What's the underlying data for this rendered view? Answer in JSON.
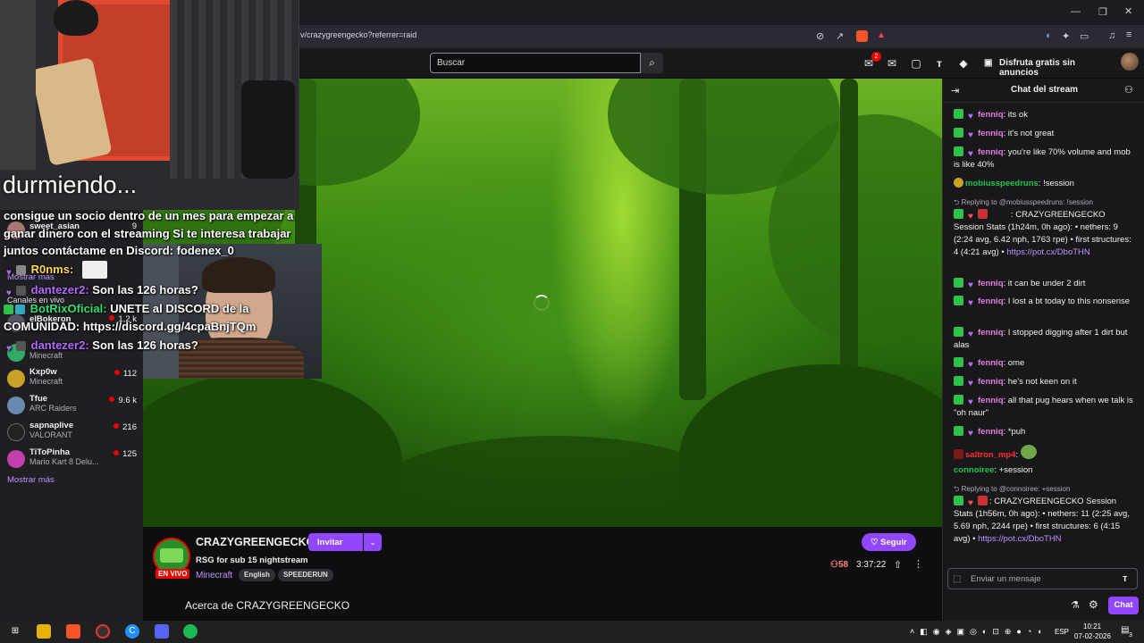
{
  "browser": {
    "url": "v/crazygreengecko?referrer=raid",
    "window_controls": [
      "minimize",
      "maximize",
      "close"
    ]
  },
  "topnav": {
    "search_placeholder": "Buscar",
    "notification_count": "2",
    "promo_label": "Disfruta gratis sin anuncios"
  },
  "overlay": {
    "title": "durmiendo...",
    "lines": [
      "consigue un socio dentro de un mes para empezar a",
      "ganar dinero con el streaming Si te interesa trabajar",
      "juntos contáctame en Discord: fodenex_0"
    ],
    "chat": [
      {
        "user": "R0nms:",
        "text": ""
      },
      {
        "user": "dantezer2:",
        "text": "Son las 126 horas?"
      },
      {
        "user": "BotRixOficial:",
        "text": "UNETE al DISCORD de la"
      },
      {
        "user": "",
        "text": "COMUNIDAD: https://discord.gg/4cpaBnjTQm"
      },
      {
        "user": "dantezer2:",
        "text": "Son las 126 horas?"
      }
    ]
  },
  "sidebar": {
    "show_more_top": "Mostrar más",
    "live_channels_label": "Canales en vivo",
    "channels": [
      {
        "name": "sweet_asian",
        "game": "",
        "viewers": "9"
      },
      {
        "name": "elBokeron",
        "game": "",
        "viewers": "1,2 k"
      },
      {
        "name": "",
        "game": "Minecraft",
        "viewers": ""
      },
      {
        "name": "Kxp0w",
        "game": "Minecraft",
        "viewers": "112"
      },
      {
        "name": "Tfue",
        "game": "ARC Raiders",
        "viewers": "9.6 k"
      },
      {
        "name": "sapnaplive",
        "game": "VALORANT",
        "viewers": "216"
      },
      {
        "name": "TiToPinha",
        "game": "Mario Kart 8 Delu...",
        "viewers": "125"
      }
    ],
    "show_more_bottom": "Mostrar más"
  },
  "stream": {
    "channel": "CRAZYGREENGECKO",
    "live_label": "EN VIVO",
    "title": "RSG for sub 15 nightstream",
    "game": "Minecraft",
    "tags": [
      "English",
      "SPEEDERUN"
    ],
    "invite_label": "Invitar",
    "follow_label": "Seguir",
    "viewers": "58",
    "uptime": "3:37:22",
    "about": "Acerca de CRAZYGREENGECKO"
  },
  "chat": {
    "title": "Chat del stream",
    "input_placeholder": "Enviar un mensaje",
    "send_label": "Chat",
    "messages": [
      {
        "user": "fenniq",
        "text": ": its ok"
      },
      {
        "user": "fenniq",
        "text": ": it's not great"
      },
      {
        "user": "fenniq",
        "text": ": you're like 70% volume and mob is like 40%"
      },
      {
        "user": "mobiusspeedruns",
        "text": ": !session"
      },
      {
        "reply": "Replying to @mobiusspeedruns: !session"
      },
      {
        "user": "",
        "text": ": CRAZYGREENGECKO Session Stats (1h24m, 0h ago): • nethers: 9 (2:24 avg, 6.42 nph, 1763 rpe) • first structures: 4 (4:21 avg) •",
        "link": "https://pot.cx/DboTHN"
      },
      {
        "user": "fenniq",
        "text": ": it can be under 2 dirt"
      },
      {
        "user": "fenniq",
        "text": ": I lost a bt today to this nonsense"
      },
      {
        "user": "fenniq",
        "text": ": I stopped digging after 1 dirt but alas"
      },
      {
        "user": "fenniq",
        "text": ": ome"
      },
      {
        "user": "fenniq",
        "text": ": he's not keen on it"
      },
      {
        "user": "fenniq",
        "text": ": all that pug hears when we talk is \"oh naur\""
      },
      {
        "user": "fenniq",
        "text": ": *puh"
      },
      {
        "user": "saltron_mp4",
        "text": ":"
      },
      {
        "user": "connoiree",
        "text": ": +session"
      },
      {
        "reply": "Replying to @connoiree: +session"
      },
      {
        "user": "",
        "text": ": CRAZYGREENGECKO Session Stats (1h56m, 0h ago): • nethers: 11 (2:25 avg, 5.69 nph, 2244 rpe) • first structures: 6 (4:15 avg) •",
        "link": "https://pot.cx/DboTHN"
      }
    ]
  },
  "taskbar": {
    "lang": "ESP",
    "time": "10:21",
    "date": "07-02-2026",
    "notif_count": "3"
  },
  "colors": {
    "accent": "#9147ff",
    "live": "#eb0400",
    "chat_user": "#e67ce2"
  }
}
